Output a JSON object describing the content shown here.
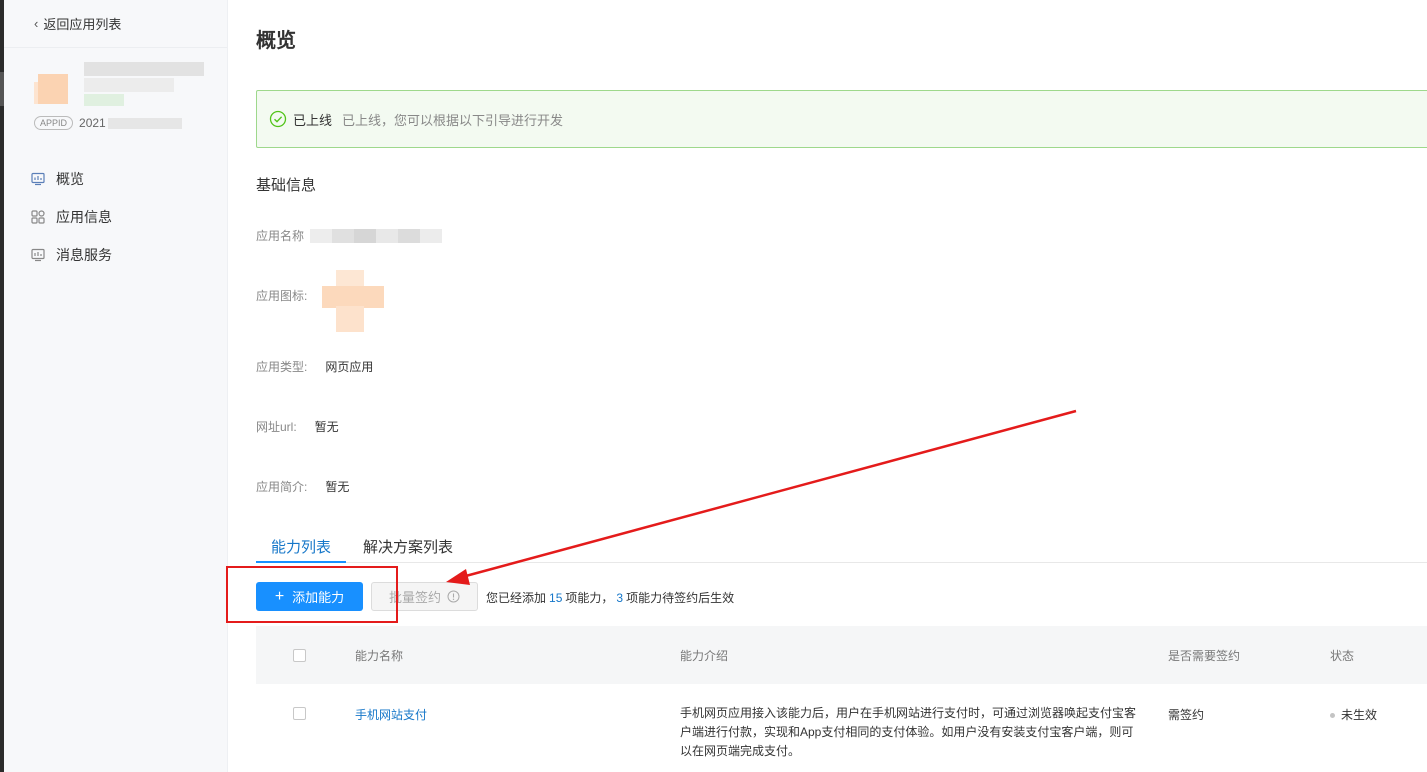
{
  "sidebar": {
    "back_label": "返回应用列表",
    "appid_badge": "APPID",
    "appid_prefix": "2021",
    "nav_items": [
      {
        "label": "概览",
        "icon": "chart-monitor-icon"
      },
      {
        "label": "应用信息",
        "icon": "grid-apps-icon"
      },
      {
        "label": "消息服务",
        "icon": "message-monitor-icon"
      }
    ]
  },
  "main": {
    "page_title": "概览",
    "alert": {
      "status": "已上线",
      "description": "已上线，您可以根据以下引导进行开发",
      "icon": "check-circle-icon"
    },
    "basic_info": {
      "title": "基础信息",
      "app_name_label": "应用名称",
      "app_icon_label": "应用图标:",
      "app_type_label": "应用类型:",
      "app_type_value": "网页应用",
      "url_label": "网址url:",
      "url_value": "暂无",
      "intro_label": "应用简介:",
      "intro_value": "暂无"
    },
    "tabs": [
      "能力列表",
      "解决方案列表"
    ],
    "toolbar": {
      "add_label": "添加能力",
      "batch_sign_label": "批量签约",
      "summary_prefix": "您已经添加",
      "summary_added": "15",
      "summary_mid": "项能力，",
      "summary_pending": "3",
      "summary_suffix": "项能力待签约后生效"
    },
    "table": {
      "columns": [
        "能力名称",
        "能力介绍",
        "是否需要签约",
        "状态"
      ],
      "rows": [
        {
          "name": "手机网站支付",
          "intro": "手机网页应用接入该能力后，用户在手机网站进行支付时，可通过浏览器唤起支付宝客户端进行付款，实现和App支付相同的支付体验。如用户没有安装支付宝客户端，则可以在网页端完成支付。",
          "sign_required": "需签约",
          "status": "未生效"
        }
      ]
    }
  },
  "colors": {
    "primary": "#1890ff",
    "link": "#1677c9",
    "success_border": "#9ed88c",
    "success_bg": "#f3faf1",
    "annotation_red": "#e41b1b"
  }
}
